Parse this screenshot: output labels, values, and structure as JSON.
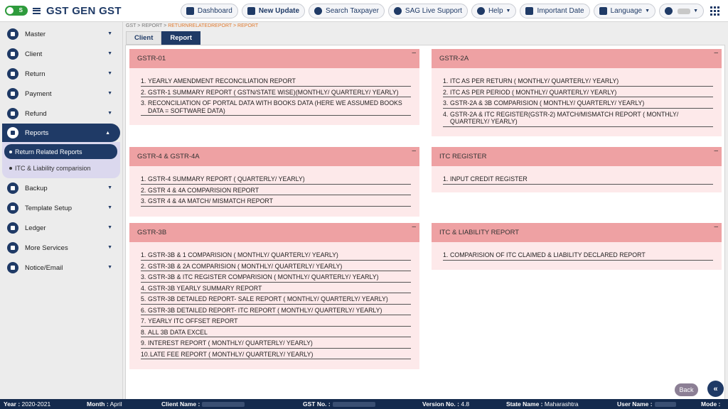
{
  "app": {
    "toggle_label": "S",
    "brand": "GST GEN GST"
  },
  "topnav": {
    "dashboard": "Dashboard",
    "new_update": "New Update",
    "search_taxpayer": "Search Taxpayer",
    "live_support": "SAG Live Support",
    "help": "Help",
    "important_date": "Important Date",
    "language": "Language"
  },
  "sidebar": {
    "items": [
      {
        "label": "Master"
      },
      {
        "label": "Client"
      },
      {
        "label": "Return"
      },
      {
        "label": "Payment"
      },
      {
        "label": "Refund"
      },
      {
        "label": "Reports"
      },
      {
        "label": "Backup"
      },
      {
        "label": "Template Setup"
      },
      {
        "label": "Ledger"
      },
      {
        "label": "More Services"
      },
      {
        "label": "Notice/Email"
      }
    ],
    "reports_sub": [
      {
        "label": "Return Related Reports"
      },
      {
        "label": "ITC & Liability comparision"
      }
    ]
  },
  "breadcrumb": {
    "items": [
      "GST",
      "REPORT",
      "RETURNRELATEDREPORT",
      "REPORT"
    ],
    "separator": ">"
  },
  "tabs": [
    {
      "label": "Client"
    },
    {
      "label": "Report"
    }
  ],
  "cards": {
    "gstr01": {
      "title": "GSTR-01",
      "items": [
        "YEARLY AMENDMENT RECONCILIATION REPORT",
        "GSTR-1 SUMMARY REPORT ( GSTN/STATE WISE)(MONTHLY/ QUARTERLY/ YEARLY)",
        "RECONCILIATION OF PORTAL DATA WITH BOOKS DATA (HERE WE ASSUMED BOOKS DATA = SOFTWARE DATA)"
      ]
    },
    "gstr2a": {
      "title": "GSTR-2A",
      "items": [
        "ITC AS PER RETURN ( MONTHLY/ QUARTERLY/ YEARLY)",
        "ITC AS PER PERIOD ( MONTHLY/ QUARTERLY/ YEARLY)",
        "GSTR-2A & 3B COMPARISION ( MONTHLY/ QUARTERLY/ YEARLY)",
        "GSTR-2A & ITC REGISTER(GSTR-2) MATCH/MISMATCH REPORT ( MONTHLY/ QUARTERLY/ YEARLY)"
      ]
    },
    "gstr4": {
      "title": "GSTR-4 & GSTR-4A",
      "items": [
        "GSTR-4 SUMMARY REPORT ( QUARTERLY/ YEARLY)",
        "GSTR 4 & 4A COMPARISION REPORT",
        "GSTR 4 & 4A MATCH/ MISMATCH REPORT"
      ]
    },
    "itcreg": {
      "title": "ITC REGISTER",
      "items": [
        "INPUT CREDIT REGISTER"
      ]
    },
    "gstr3b": {
      "title": "GSTR-3B",
      "items": [
        "GSTR-3B & 1 COMPARISION ( MONTHLY/ QUARTERLY/ YEARLY)",
        "GSTR-3B & 2A COMPARISION ( MONTHLY/ QUARTERLY/ YEARLY)",
        "GSTR-3B & ITC REGISTER COMPARISION ( MONTHLY/ QUARTERLY/ YEARLY)",
        "GSTR-3B YEARLY SUMMARY REPORT",
        "GSTR-3B DETAILED REPORT- SALE REPORT ( MONTHLY/ QUARTERLY/ YEARLY)",
        "GSTR-3B DETAILED REPORT- ITC REPORT ( MONTHLY/ QUARTERLY/ YEARLY)",
        "YEARLY ITC OFFSET REPORT",
        "ALL 3B DATA EXCEL",
        "INTEREST REPORT ( MONTHLY/ QUARTERLY/ YEARLY)",
        "LATE FEE REPORT ( MONTHLY/ QUARTERLY/ YEARLY)"
      ]
    },
    "itcliab": {
      "title": "ITC & LIABILITY REPORT",
      "items": [
        "COMPARISION OF ITC CLAIMED & LIABILITY DECLARED REPORT"
      ]
    }
  },
  "buttons": {
    "back": "Back",
    "collapse": "«"
  },
  "status": {
    "year_label": "Year :",
    "year_value": "2020-2021",
    "month_label": "Month :",
    "month_value": "April",
    "client_label": "Client Name :",
    "gst_label": "GST No. :",
    "version_label": "Version No. :",
    "version_value": "4.8",
    "state_label": "State Name :",
    "state_value": "Maharashtra",
    "user_label": "User Name :",
    "mode_label": "Mode :"
  },
  "colors": {
    "primary": "#1f3a66",
    "card_header": "#eea1a3",
    "card_body": "#fde9ea",
    "breadcrumb_current": "#e07a2e",
    "toggle_on": "#2e9b3c",
    "status_bar": "#142a4d"
  }
}
